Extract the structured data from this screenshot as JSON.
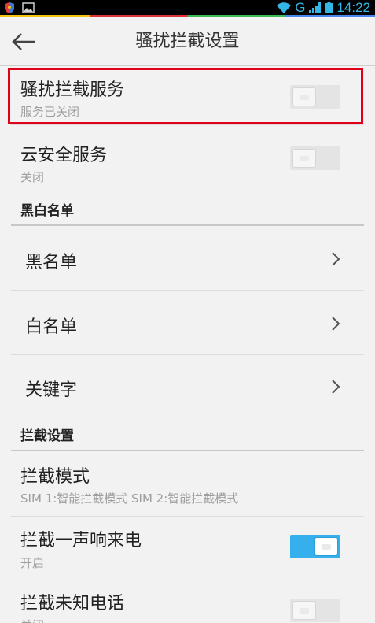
{
  "status_bar": {
    "network": "G",
    "time": "14:22",
    "accent_colors": [
      "#f4c20d",
      "#db3236",
      "#3cba54",
      "#4885ed"
    ]
  },
  "title_bar": {
    "title": "骚扰拦截设置",
    "back_icon": "arrow-left-icon"
  },
  "settings": {
    "harassment_service": {
      "title": "骚扰拦截服务",
      "status": "服务已关闭",
      "enabled": false
    },
    "cloud_security": {
      "title": "云安全服务",
      "status": "关闭",
      "enabled": false
    },
    "section_lists": {
      "label": "黑白名单"
    },
    "blacklist": {
      "title": "黑名单"
    },
    "whitelist": {
      "title": "白名单"
    },
    "keywords": {
      "title": "关键字"
    },
    "section_intercept": {
      "label": "拦截设置"
    },
    "intercept_mode": {
      "title": "拦截模式",
      "status": "SIM 1:智能拦截模式   SIM 2:智能拦截模式"
    },
    "ring_once": {
      "title": "拦截一声响来电",
      "status": "开启",
      "enabled": true
    },
    "unknown_calls": {
      "title": "拦截未知电话",
      "status": "关闭",
      "enabled": false
    }
  },
  "colors": {
    "highlight": "#e0001a",
    "toggle_on": "#36b0ec",
    "status_text": "#33b5e5"
  }
}
